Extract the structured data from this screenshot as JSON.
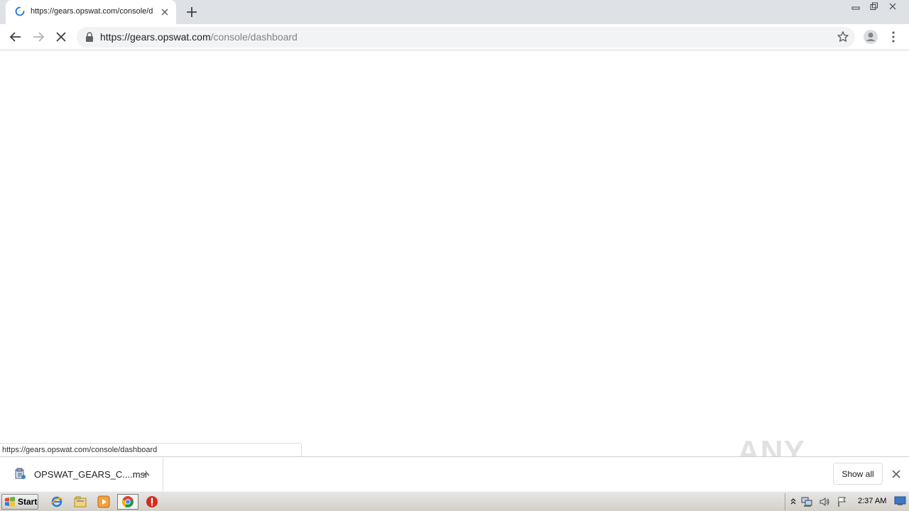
{
  "browser": {
    "tab": {
      "title": "https://gears.opswat.com/console/d"
    },
    "address": {
      "host": "https://gears.opswat.com",
      "path": "/console/dashboard"
    },
    "status_url": "https://gears.opswat.com/console/dashboard"
  },
  "download_shelf": {
    "item_name": "OPSWAT_GEARS_C....msi",
    "show_all_label": "Show all"
  },
  "watermark": {
    "text": "ANY RUN"
  },
  "taskbar": {
    "start_label": "Start",
    "clock": "2:37 AM",
    "apps": [
      "internet-explorer-icon",
      "explorer-folder-icon",
      "media-player-icon",
      "chrome-icon",
      "stop-icon"
    ]
  },
  "colors": {
    "tabstrip_bg": "#dee1e6",
    "omnibox_bg": "#f1f3f4",
    "accent_blue": "#1a73e8",
    "taskbar_bg": "#d4d0c8"
  }
}
